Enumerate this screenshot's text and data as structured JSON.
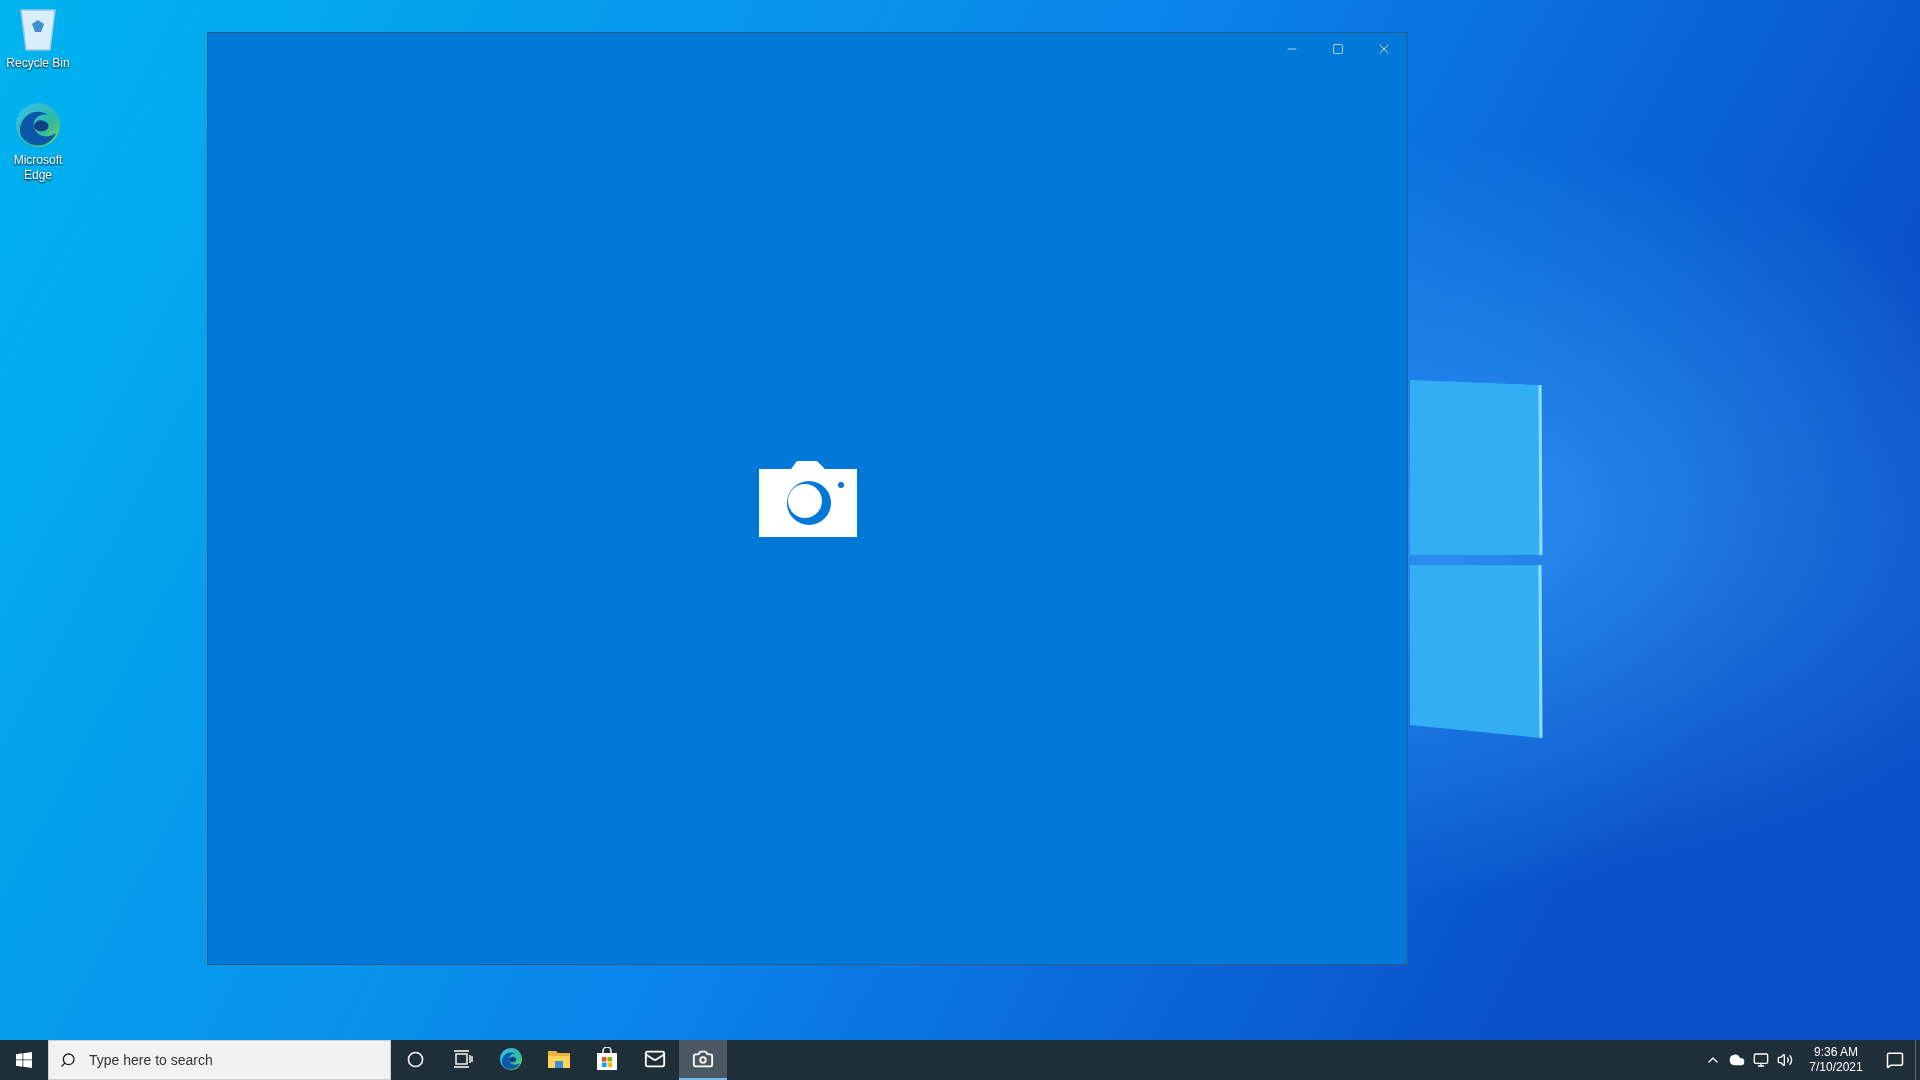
{
  "desktop_icons": [
    {
      "kind": "recycle-bin",
      "label": "Recycle Bin"
    },
    {
      "kind": "edge",
      "label": "Microsoft Edge"
    }
  ],
  "window": {
    "kind": "camera-splash"
  },
  "taskbar": {
    "search": {
      "placeholder": "Type here to search"
    },
    "apps": [
      {
        "kind": "cortana",
        "selected": false
      },
      {
        "kind": "task-view",
        "selected": false
      },
      {
        "kind": "edge",
        "selected": false
      },
      {
        "kind": "explorer",
        "selected": false
      },
      {
        "kind": "store",
        "selected": false
      },
      {
        "kind": "mail",
        "selected": false
      },
      {
        "kind": "camera",
        "selected": true
      }
    ],
    "clock": {
      "time": "9:36 AM",
      "date": "7/10/2021"
    }
  }
}
